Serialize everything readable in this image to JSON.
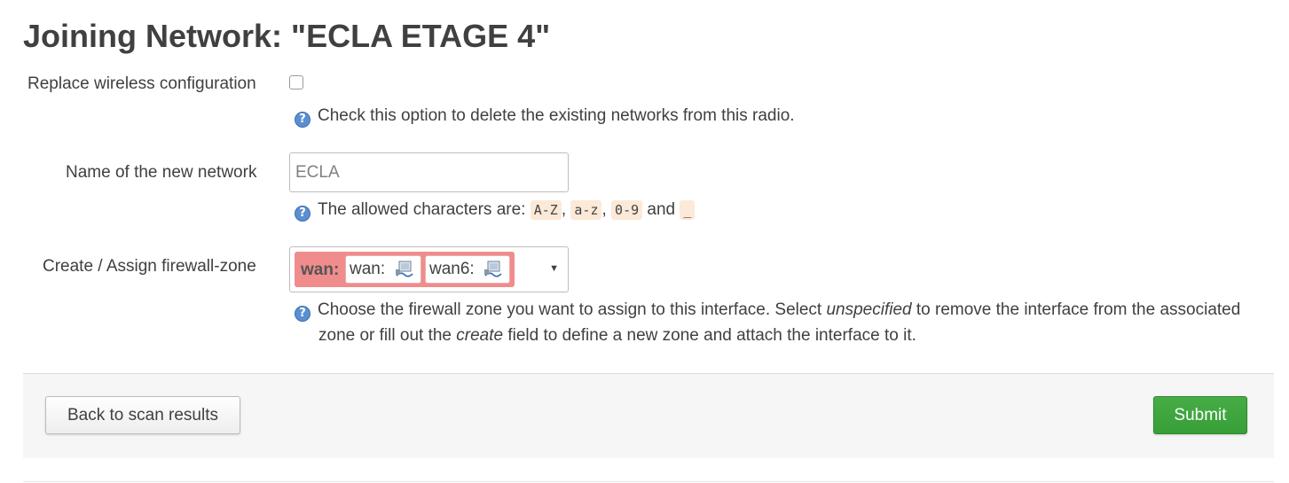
{
  "page": {
    "title": "Joining Network: \"ECLA ETAGE 4\""
  },
  "replace_wireless": {
    "label": "Replace wireless configuration",
    "checked": false,
    "help": "Check this option to delete the existing networks from this radio."
  },
  "network_name": {
    "label": "Name of the new network",
    "placeholder": "ECLA",
    "value": "",
    "help_prefix": "The allowed characters are:",
    "chars": [
      "A-Z",
      "a-z",
      "0-9",
      "_"
    ],
    "sep_comma": ",",
    "sep_and": "and"
  },
  "firewall_zone": {
    "label": "Create / Assign firewall-zone",
    "selected_zone": "wan:",
    "interfaces": [
      "wan:",
      "wan6:"
    ],
    "interface_icon": "network-interface-icon",
    "zone_color": "#f08c8c",
    "help_part1": "Choose the firewall zone you want to assign to this interface. Select",
    "help_em1": "unspecified",
    "help_part2": "to remove the interface from the associated",
    "help_part3": "zone or fill out the",
    "help_em2": "create",
    "help_part4": "field to define a new zone and attach the interface to it."
  },
  "actions": {
    "back_label": "Back to scan results",
    "submit_label": "Submit",
    "submit_color": "#3fa63f"
  },
  "icons": {
    "help": "help-icon",
    "dropdown": "caret-down-icon"
  }
}
